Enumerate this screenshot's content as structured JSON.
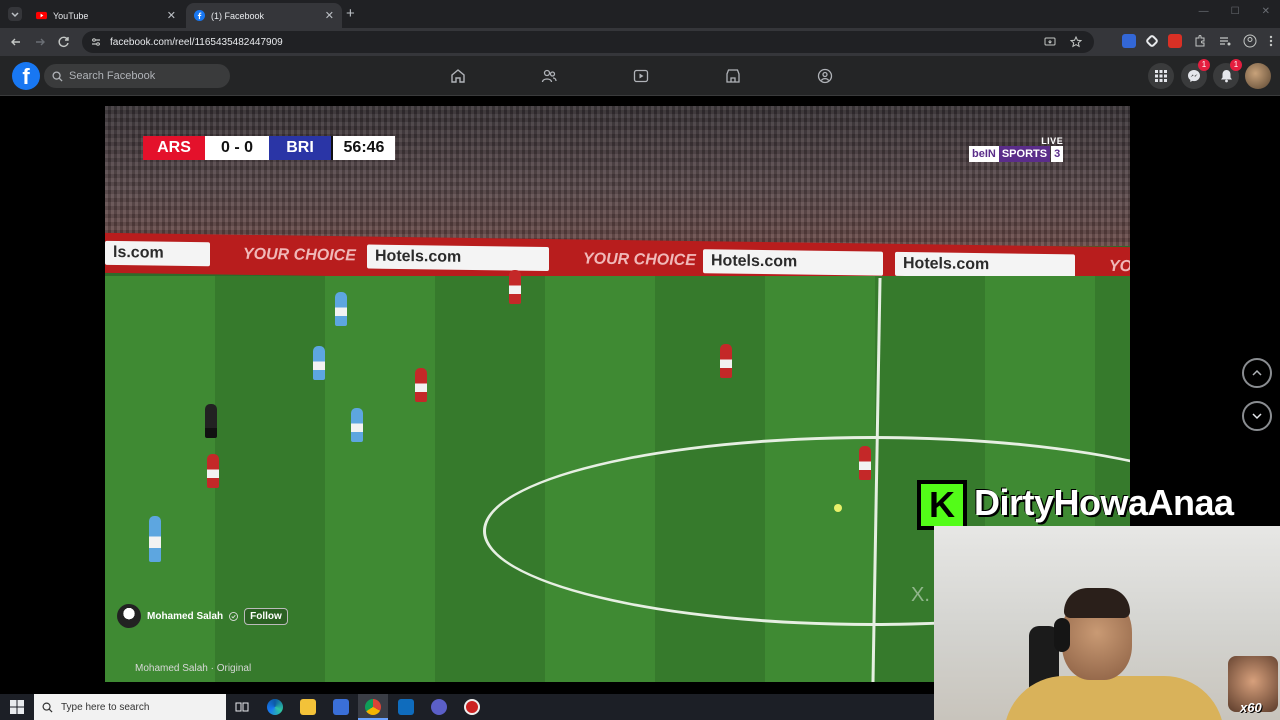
{
  "browser": {
    "tabs": [
      {
        "title": "YouTube",
        "icon": "youtube-icon",
        "active": false
      },
      {
        "title": "(1) Facebook",
        "icon": "facebook-icon",
        "active": true
      }
    ],
    "new_tab_label": "+",
    "url": "facebook.com/reel/1165435482447909"
  },
  "facebook": {
    "logo_letter": "f",
    "search_placeholder": "Search Facebook",
    "nav_icons": [
      "home-icon",
      "friends-icon",
      "watch-icon",
      "marketplace-icon",
      "groups-icon"
    ],
    "menu_icon": "apps-grid-icon",
    "messenger_badge": "1",
    "notifications_badge": "1"
  },
  "reel": {
    "scoreboard": {
      "home": "ARS",
      "score": "0 - 0",
      "away": "BRI",
      "clock": "56:46"
    },
    "broadcaster": {
      "live": "LIVE",
      "brand_a": "beIN",
      "brand_b": "SPORTS",
      "channel": "3"
    },
    "ads": [
      "ls.com",
      "YOUR CHOICE",
      "Hotels.com",
      "YOUR CHOICE",
      "Hotels.com",
      "Hotels.com",
      "YOU"
    ],
    "watermark": "X.",
    "author": "Mohamed Salah",
    "verified_icon": "verified-badge-icon",
    "follow_label": "Follow",
    "caption": "Mohamed Salah · Original"
  },
  "stream_overlay": {
    "platform_logo_letter": "K",
    "streamer_name": "DirtyHowaAnaa",
    "multiplier": "x60"
  },
  "taskbar": {
    "search_placeholder": "Type here to search",
    "apps": [
      "task-view-icon",
      "edge-icon",
      "file-explorer-icon",
      "store-icon",
      "chrome-icon",
      "outlook-icon",
      "app-icon",
      "app-icon-2"
    ]
  },
  "colors": {
    "fb_blue": "#1877f2",
    "arsenal_red": "#e4112b",
    "brighton_blue": "#2a35a6",
    "kick_green": "#53fc18"
  }
}
